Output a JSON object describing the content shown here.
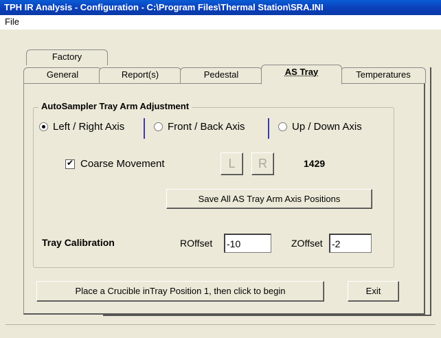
{
  "window": {
    "title": "TPH IR Analysis - Configuration - C:\\Program Files\\Thermal Station\\SRA.INI"
  },
  "menu": {
    "file_label": "File"
  },
  "tabs": {
    "factory": "Factory",
    "general": "General",
    "reports": "Report(s)",
    "pedestal": "Pedestal",
    "as_tray": "AS Tray",
    "temperatures": "Temperatures",
    "selected": "AS Tray"
  },
  "group": {
    "title": "AutoSampler Tray Arm Adjustment",
    "axes": [
      {
        "label": "Left / Right Axis",
        "selected": true
      },
      {
        "label": "Front / Back Axis",
        "selected": false
      },
      {
        "label": "Up / Down Axis",
        "selected": false
      }
    ],
    "coarse_movement_label": "Coarse Movement",
    "coarse_movement_checked": true,
    "left_button": "L",
    "right_button": "R",
    "position_value": "1429",
    "save_button": "Save All AS Tray Arm Axis Positions",
    "tray_calibration_label": "Tray Calibration",
    "roffset_label": "ROffset",
    "roffset_value": "-10",
    "zoffset_label": "ZOffset",
    "zoffset_value": "-2"
  },
  "footer": {
    "place_button": "Place a Crucible inTray Position 1, then click to begin",
    "exit_button": "Exit"
  },
  "colors": {
    "titlebar": "#0b3fb8",
    "background": "#ece9d8",
    "separator": "#3a3ab0"
  }
}
